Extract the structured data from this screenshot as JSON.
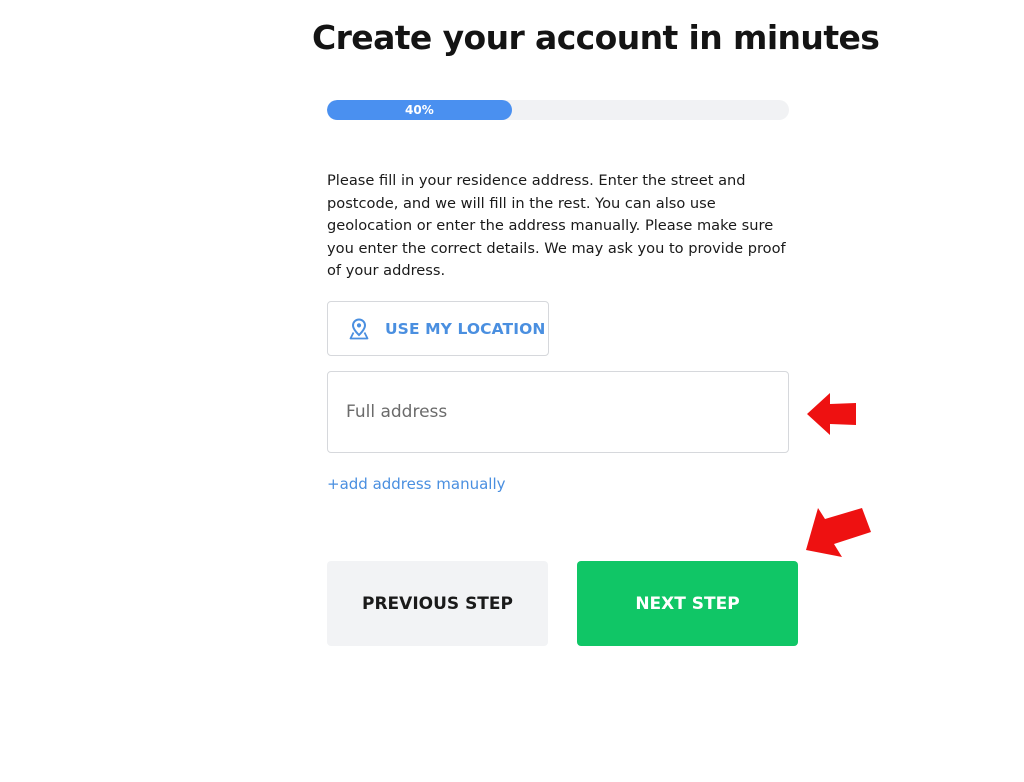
{
  "header": {
    "title": "Create your account in minutes"
  },
  "progress": {
    "value": 0.4,
    "label": "40%"
  },
  "address_step": {
    "instructions": "Please fill in your residence address. Enter the street and postcode, and we will fill in the rest. You can also use geolocation or enter the address manually. Please make sure you enter the correct details. We may ask you to provide proof of your address.",
    "location_button_label": "USE MY LOCATION",
    "location_icon": "map-pin-icon",
    "address_value": "",
    "address_placeholder": "Full address",
    "manual_link_label": "+add address manually"
  },
  "actions": {
    "previous_label": "PREVIOUS STEP",
    "next_label": "NEXT STEP"
  },
  "annotations": {
    "arrow_icon": "red-arrow-icon",
    "arrow_color": "#ee1111"
  },
  "colors": {
    "accent_blue": "#4a90f0",
    "link_blue": "#4a8fe0",
    "next_green": "#10c666",
    "secondary_gray": "#f2f3f5"
  }
}
